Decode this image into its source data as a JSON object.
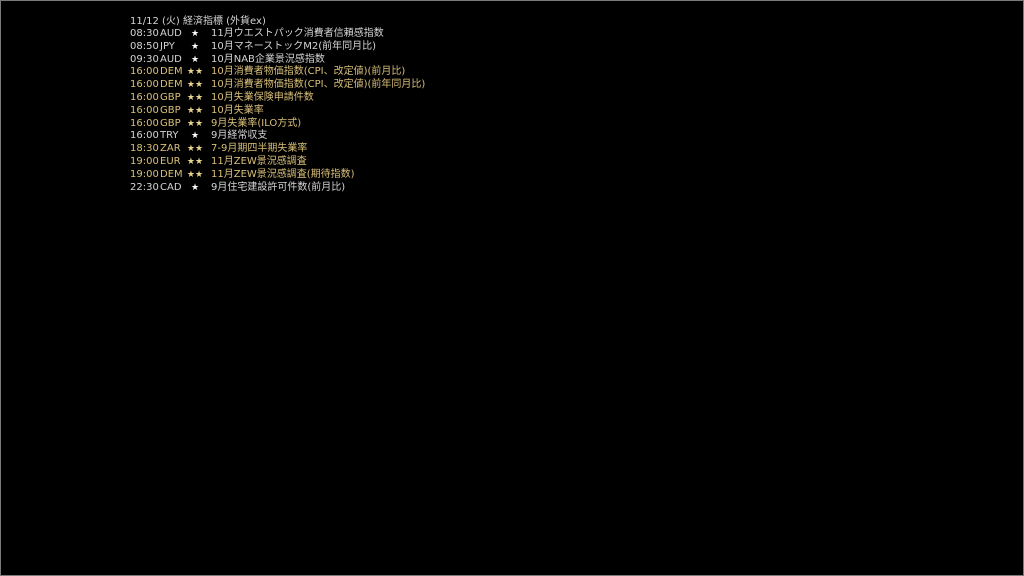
{
  "screen": {
    "title": "11/12 (火) 経済指標 (外貨ex)"
  },
  "colors": {
    "background": "#000000",
    "text_normal": "#d4d4d4",
    "text_highlight": "#d9bf78",
    "star_normal": "#ffffff",
    "star_highlight": "#ead58e"
  },
  "events": [
    {
      "time": "08:30",
      "currency": "AUD",
      "stars": "★",
      "importance": 1,
      "name": "11月ウエストパック消費者信頼感指数"
    },
    {
      "time": "08:50",
      "currency": "JPY",
      "stars": "★",
      "importance": 1,
      "name": "10月マネーストックM2(前年同月比)"
    },
    {
      "time": "09:30",
      "currency": "AUD",
      "stars": "★",
      "importance": 1,
      "name": "10月NAB企業景況感指数"
    },
    {
      "time": "16:00",
      "currency": "DEM",
      "stars": "★★",
      "importance": 2,
      "name": "10月消費者物価指数(CPI、改定値)(前月比)"
    },
    {
      "time": "16:00",
      "currency": "DEM",
      "stars": "★★",
      "importance": 2,
      "name": "10月消費者物価指数(CPI、改定値)(前年同月比)"
    },
    {
      "time": "16:00",
      "currency": "GBP",
      "stars": "★★",
      "importance": 2,
      "name": "10月失業保険申請件数"
    },
    {
      "time": "16:00",
      "currency": "GBP",
      "stars": "★★",
      "importance": 2,
      "name": "10月失業率"
    },
    {
      "time": "16:00",
      "currency": "GBP",
      "stars": "★★",
      "importance": 2,
      "name": "9月失業率(ILO方式)"
    },
    {
      "time": "16:00",
      "currency": "TRY",
      "stars": "★",
      "importance": 1,
      "name": "9月経常収支"
    },
    {
      "time": "18:30",
      "currency": "ZAR",
      "stars": "★★",
      "importance": 2,
      "name": "7-9月期四半期失業率"
    },
    {
      "time": "19:00",
      "currency": "EUR",
      "stars": "★★",
      "importance": 2,
      "name": "11月ZEW景況感調査"
    },
    {
      "time": "19:00",
      "currency": "DEM",
      "stars": "★★",
      "importance": 2,
      "name": "11月ZEW景況感調査(期待指数)"
    },
    {
      "time": "22:30",
      "currency": "CAD",
      "stars": "★",
      "importance": 1,
      "name": "9月住宅建設許可件数(前月比)"
    }
  ]
}
